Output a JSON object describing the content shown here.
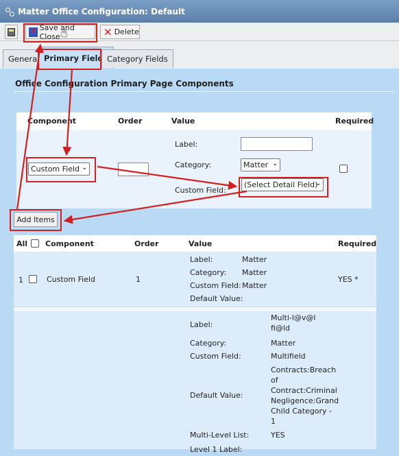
{
  "window": {
    "title": "Matter Office Configuration: Default"
  },
  "toolbar": {
    "save_close_label": "Save and Close",
    "delete_label": "Delete"
  },
  "tabs": [
    {
      "label": "General"
    },
    {
      "label": "Primary Fields"
    },
    {
      "label": "Category Fields"
    }
  ],
  "section_title": "Office Configuration Primary Page Components",
  "form": {
    "headers": {
      "component": "Component",
      "order": "Order",
      "value": "Value",
      "required": "Required"
    },
    "component_select": "Custom Field",
    "order_value": "",
    "label_caption": "Label:",
    "label_value": "",
    "category_caption": "Category:",
    "category_select": "Matter",
    "custom_field_caption": "Custom Field:",
    "custom_field_select": "(Select Detail Field)",
    "required_checked": false
  },
  "add_items_label": "Add Items",
  "list": {
    "headers": {
      "all": "All",
      "component": "Component",
      "order": "Order",
      "value": "Value",
      "required": "Required"
    },
    "rows": [
      {
        "num": "1",
        "component": "Custom Field",
        "order": "1",
        "required": "YES *",
        "values": [
          {
            "k": "Label:",
            "v": "Matter"
          },
          {
            "k": "Category:",
            "v": "Matter"
          },
          {
            "k": "Custom Field:",
            "v": "Matter"
          },
          {
            "k": "Default Value:",
            "v": ""
          }
        ]
      },
      {
        "values": [
          {
            "k": "Label:",
            "v": "Multi-l@v@l fi@ld"
          },
          {
            "k": "Category:",
            "v": "Matter"
          },
          {
            "k": "Custom Field:",
            "v": "Multifield"
          },
          {
            "k": "Default Value:",
            "v": "Contracts:Breach of Contract:Criminal Negligence:Grand Child Category - 1"
          },
          {
            "k": "Multi-Level List:",
            "v": "YES"
          },
          {
            "k": "Level 1 Label:",
            "v": ""
          }
        ]
      }
    ]
  },
  "colors": {
    "highlight": "#d21f1f",
    "background": "#b9d9f4",
    "titlebar": "#5b7fa8"
  }
}
